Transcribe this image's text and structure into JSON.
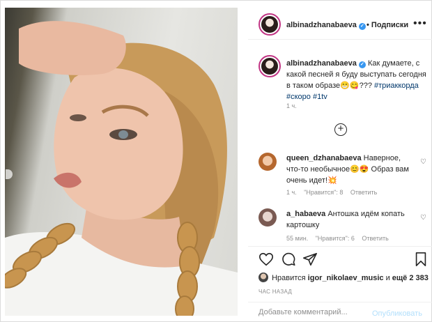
{
  "post": {
    "author": "albinadzhanabaeva",
    "separator": "•",
    "follow_label": "Подписки",
    "more_label": "•••",
    "caption": {
      "text": "Как думаете, с какой песней я буду выступать сегодня в таком образе",
      "emoji": "😁😋",
      "question_marks": "???",
      "hashtags": [
        "#триаккорда",
        "#скоро",
        "#1tv"
      ],
      "time": "1 ч."
    },
    "comments": [
      {
        "username": "queen_dzhanabaeva",
        "text": "Наверное, что-то необычное😊😍 Образ вам очень идет!💥",
        "time": "1 ч.",
        "likes": "\"Нравится\": 8",
        "reply": "Ответить"
      },
      {
        "username": "a_habaeva",
        "text": "Антошка идём копать картошку",
        "time": "55 мин.",
        "likes": "\"Нравится\": 6",
        "reply": "Ответить"
      }
    ],
    "likes": {
      "prefix": "Нравится",
      "user": "igor_nikolaev_music",
      "and": "и",
      "others": "ещё 2 383"
    },
    "posted": "ЧАС НАЗАД",
    "comment_input": {
      "placeholder": "Добавьте комментарий...",
      "submit_label": "Опубликовать"
    }
  },
  "icons": {
    "like": "heart-icon",
    "comment": "comment-icon",
    "share": "paper-plane-icon",
    "save": "bookmark-icon",
    "load_more": "plus-circle-icon",
    "verified": "verified-badge-icon"
  },
  "colors": {
    "link": "#00376b",
    "muted": "#8e8e8e",
    "verified": "#3897f0",
    "story_ring": "#c13584",
    "publish_disabled": "#b2dffc"
  }
}
